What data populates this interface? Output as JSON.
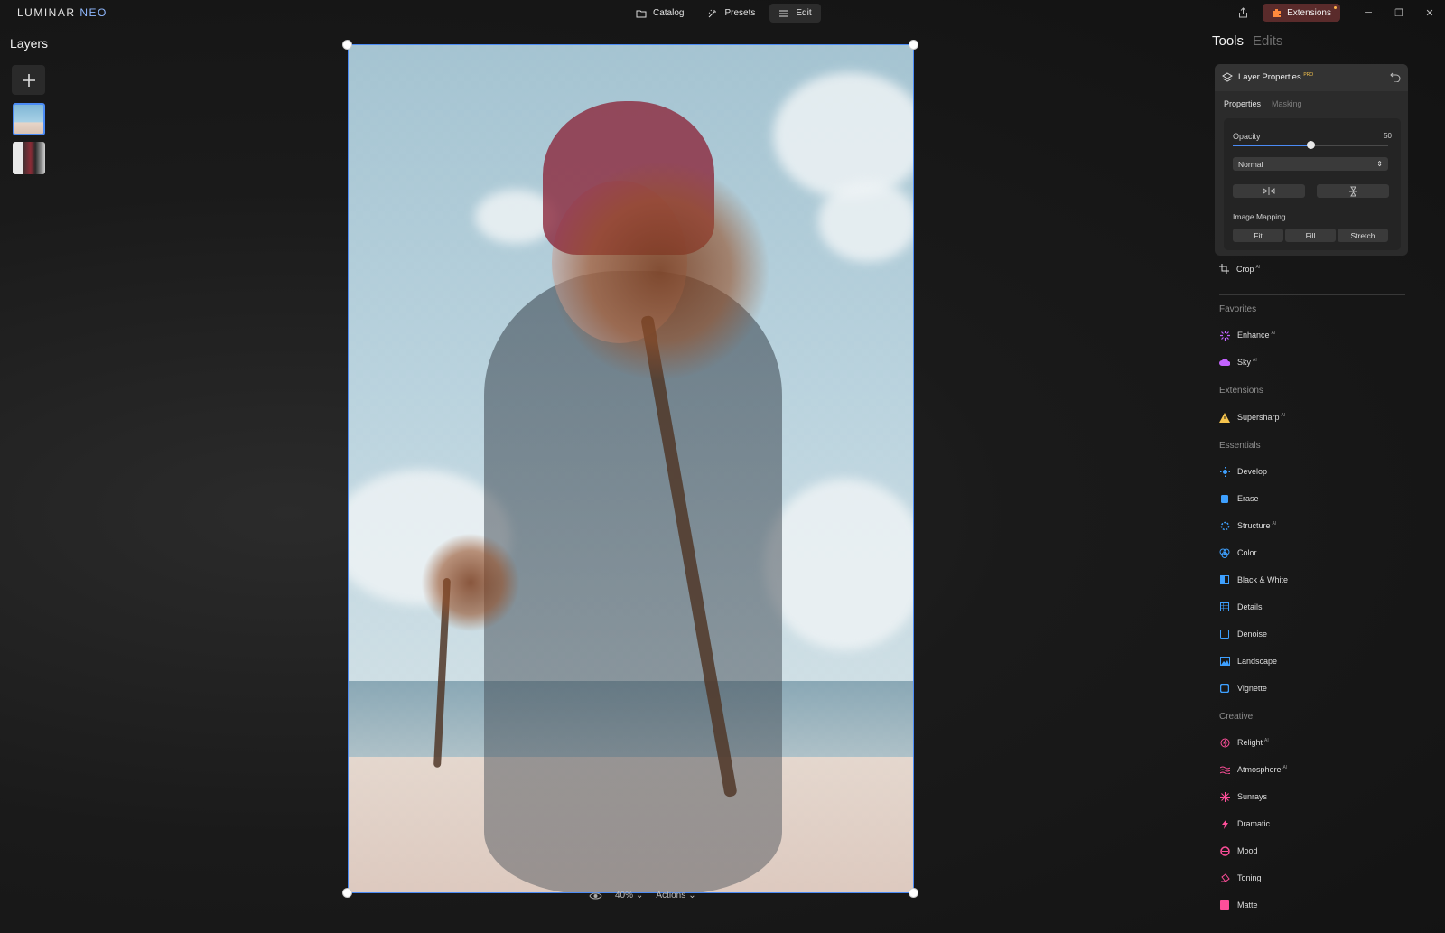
{
  "app": {
    "logo_main": "LUMINAR",
    "logo_sub": "NEO"
  },
  "nav": {
    "catalog": "Catalog",
    "presets": "Presets",
    "edit": "Edit"
  },
  "window": {
    "extensions": "Extensions",
    "minimize": "─",
    "restore": "❐",
    "close": "✕"
  },
  "layers": {
    "title": "Layers"
  },
  "canvas_bar": {
    "zoom": "40%",
    "actions": "Actions"
  },
  "panel": {
    "tab_tools": "Tools",
    "tab_edits": "Edits"
  },
  "layer_props": {
    "title": "Layer Properties",
    "pro_badge": "PRO",
    "tab_properties": "Properties",
    "tab_masking": "Masking",
    "opacity_label": "Opacity",
    "opacity_value": "50",
    "opacity_fraction": 0.5,
    "blend_mode": "Normal",
    "mapping_label": "Image Mapping",
    "mapping_fit": "Fit",
    "mapping_fill": "Fill",
    "mapping_stretch": "Stretch"
  },
  "crop": {
    "label": "Crop",
    "ai": "AI"
  },
  "sections": {
    "favorites": "Favorites",
    "extensions": "Extensions",
    "essentials": "Essentials",
    "creative": "Creative"
  },
  "tools": {
    "enhance": "Enhance",
    "sky": "Sky",
    "supersharp": "Supersharp",
    "develop": "Develop",
    "erase": "Erase",
    "structure": "Structure",
    "color": "Color",
    "bw": "Black & White",
    "details": "Details",
    "denoise": "Denoise",
    "landscape": "Landscape",
    "vignette": "Vignette",
    "relight": "Relight",
    "atmosphere": "Atmosphere",
    "sunrays": "Sunrays",
    "dramatic": "Dramatic",
    "mood": "Mood",
    "toning": "Toning",
    "matte": "Matte"
  },
  "ai_badge": "AI",
  "colors": {
    "accent": "#4b8bf5",
    "extensions_bg": "#5a2b2b",
    "favorites_icon": "#c463ff",
    "essentials_icon": "#3ea0ff",
    "creative_icon": "#ff4f9a"
  }
}
